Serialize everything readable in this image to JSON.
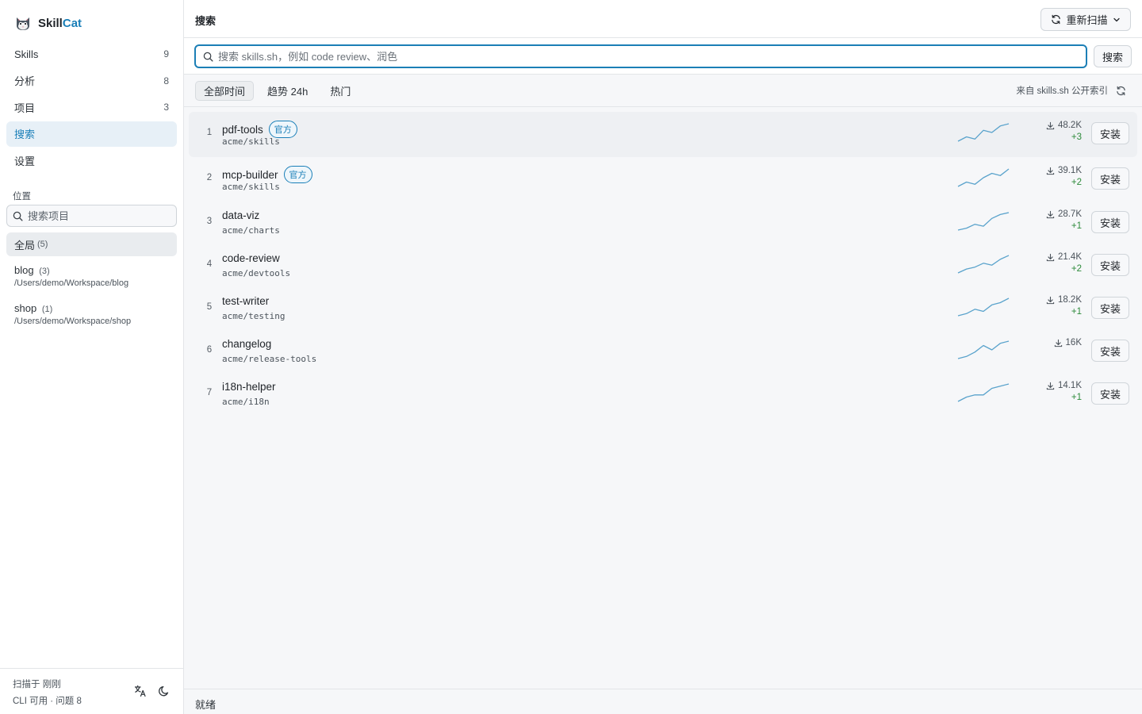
{
  "app": {
    "name_part1": "Skill",
    "name_part2": "Cat",
    "accent_color": "#1a7fb8"
  },
  "sidebar": {
    "nav": [
      {
        "label": "Skills",
        "count": "9",
        "icon": "skills"
      },
      {
        "label": "分析",
        "count": "8",
        "icon": "analytics"
      },
      {
        "label": "项目",
        "count": "3",
        "icon": "projects"
      },
      {
        "label": "搜索",
        "count": "",
        "icon": "search",
        "active": true
      },
      {
        "label": "设置",
        "count": "",
        "icon": "settings"
      }
    ],
    "location_label": "位置",
    "project_search_placeholder": "搜索项目",
    "projects": {
      "global": {
        "name": "全局",
        "count": "(5)"
      },
      "items": [
        {
          "name": "blog",
          "count": "(3)",
          "path": "/Users/demo/Workspace/blog"
        },
        {
          "name": "shop",
          "count": "(1)",
          "path": "/Users/demo/Workspace/shop"
        }
      ]
    },
    "footer": {
      "scan_text": "扫描于 刚刚",
      "status_text": "CLI 可用 · 问题 8",
      "icons": [
        "translate-icon",
        "moon-icon"
      ]
    }
  },
  "header": {
    "title": "搜索",
    "rescan_label": "重新扫描"
  },
  "search": {
    "placeholder": "搜索 skills.sh，例如 code review、润色",
    "value": "",
    "button_label": "搜索"
  },
  "tabs": [
    {
      "label": "全部时间",
      "active": true
    },
    {
      "label": "趋势 24h",
      "active": false
    },
    {
      "label": "热门",
      "active": false
    }
  ],
  "source_label": "来自 skills.sh 公开索引",
  "results": [
    {
      "rank": "1",
      "name": "pdf-tools",
      "badge": "官方",
      "repo": "acme/skills",
      "downloads": "48.2K",
      "delta": "+3",
      "trend": [
        3,
        5,
        4,
        8,
        7,
        10,
        11
      ],
      "install": "安装"
    },
    {
      "rank": "2",
      "name": "mcp-builder",
      "badge": "官方",
      "repo": "acme/skills",
      "downloads": "39.1K",
      "delta": "+2",
      "trend": [
        2,
        4,
        3,
        6,
        8,
        7,
        10
      ],
      "install": "安装"
    },
    {
      "rank": "3",
      "name": "data-viz",
      "badge": "",
      "repo": "acme/charts",
      "downloads": "28.7K",
      "delta": "+1",
      "trend": [
        1,
        2,
        4,
        3,
        7,
        9,
        10
      ],
      "install": "安装"
    },
    {
      "rank": "4",
      "name": "code-review",
      "badge": "",
      "repo": "acme/devtools",
      "downloads": "21.4K",
      "delta": "+2",
      "trend": [
        2,
        4,
        5,
        7,
        6,
        9,
        11
      ],
      "install": "安装"
    },
    {
      "rank": "5",
      "name": "test-writer",
      "badge": "",
      "repo": "acme/testing",
      "downloads": "18.2K",
      "delta": "+1",
      "trend": [
        2,
        3,
        5,
        4,
        7,
        8,
        10
      ],
      "install": "安装"
    },
    {
      "rank": "6",
      "name": "changelog",
      "badge": "",
      "repo": "acme/release-tools",
      "downloads": "16K",
      "delta": "",
      "trend": [
        2,
        3,
        5,
        8,
        6,
        9,
        10
      ],
      "install": "安装"
    },
    {
      "rank": "7",
      "name": "i18n-helper",
      "badge": "",
      "repo": "acme/i18n",
      "downloads": "14.1K",
      "delta": "+1",
      "trend": [
        1,
        3,
        4,
        4,
        7,
        8,
        9
      ],
      "install": "安装"
    }
  ],
  "status": "就绪"
}
